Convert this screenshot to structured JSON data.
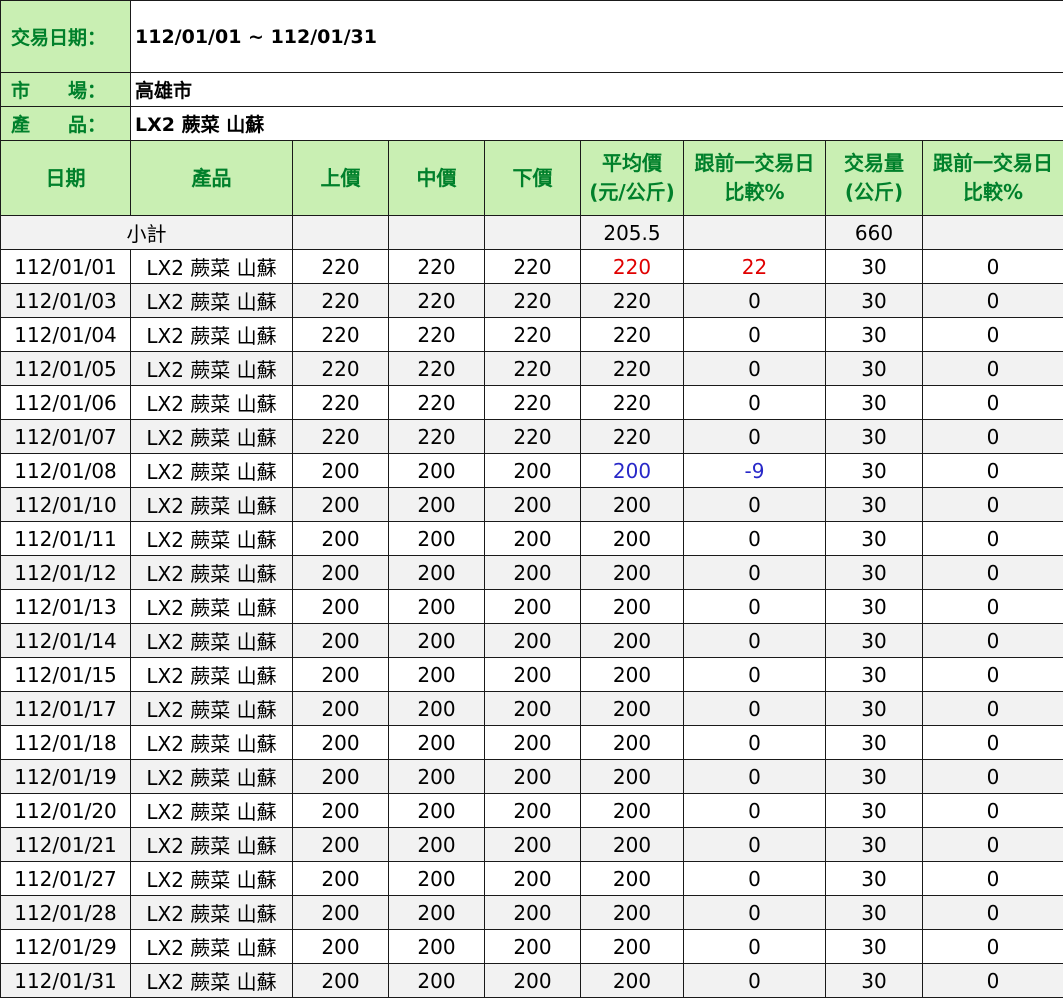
{
  "info": {
    "date_label": "交易日期：",
    "date_value": "112/01/01 ~ 112/01/31",
    "market_label": "市　　場：",
    "market_value": "高雄市",
    "product_label": "產　　品：",
    "product_value": "LX2 蕨菜 山蘇"
  },
  "headers": {
    "date": "日期",
    "product": "產品",
    "upper": "上價",
    "middle": "中價",
    "lower": "下價",
    "avg_line1": "平均價",
    "avg_line2": "(元/公斤)",
    "avg_cmp_line1": "跟前一交易日",
    "avg_cmp_line2": "比較%",
    "vol_line1": "交易量",
    "vol_line2": "(公斤)",
    "vol_cmp_line1": "跟前一交易日",
    "vol_cmp_line2": "比較%"
  },
  "subtotal": {
    "label": "小計",
    "avg": "205.5",
    "volume": "660"
  },
  "colors": {
    "header_bg": "#c9efb3",
    "header_text": "#00802b",
    "increase": "#e00000",
    "decrease": "#2828c8"
  },
  "rows": [
    {
      "date": "112/01/01",
      "product": "LX2 蕨菜 山蘇",
      "upper": "220",
      "middle": "220",
      "lower": "220",
      "avg": "220",
      "avg_cmp": "22",
      "volume": "30",
      "vol_cmp": "0",
      "trend": "up"
    },
    {
      "date": "112/01/03",
      "product": "LX2 蕨菜 山蘇",
      "upper": "220",
      "middle": "220",
      "lower": "220",
      "avg": "220",
      "avg_cmp": "0",
      "volume": "30",
      "vol_cmp": "0",
      "trend": ""
    },
    {
      "date": "112/01/04",
      "product": "LX2 蕨菜 山蘇",
      "upper": "220",
      "middle": "220",
      "lower": "220",
      "avg": "220",
      "avg_cmp": "0",
      "volume": "30",
      "vol_cmp": "0",
      "trend": ""
    },
    {
      "date": "112/01/05",
      "product": "LX2 蕨菜 山蘇",
      "upper": "220",
      "middle": "220",
      "lower": "220",
      "avg": "220",
      "avg_cmp": "0",
      "volume": "30",
      "vol_cmp": "0",
      "trend": ""
    },
    {
      "date": "112/01/06",
      "product": "LX2 蕨菜 山蘇",
      "upper": "220",
      "middle": "220",
      "lower": "220",
      "avg": "220",
      "avg_cmp": "0",
      "volume": "30",
      "vol_cmp": "0",
      "trend": ""
    },
    {
      "date": "112/01/07",
      "product": "LX2 蕨菜 山蘇",
      "upper": "220",
      "middle": "220",
      "lower": "220",
      "avg": "220",
      "avg_cmp": "0",
      "volume": "30",
      "vol_cmp": "0",
      "trend": ""
    },
    {
      "date": "112/01/08",
      "product": "LX2 蕨菜 山蘇",
      "upper": "200",
      "middle": "200",
      "lower": "200",
      "avg": "200",
      "avg_cmp": "-9",
      "volume": "30",
      "vol_cmp": "0",
      "trend": "down"
    },
    {
      "date": "112/01/10",
      "product": "LX2 蕨菜 山蘇",
      "upper": "200",
      "middle": "200",
      "lower": "200",
      "avg": "200",
      "avg_cmp": "0",
      "volume": "30",
      "vol_cmp": "0",
      "trend": ""
    },
    {
      "date": "112/01/11",
      "product": "LX2 蕨菜 山蘇",
      "upper": "200",
      "middle": "200",
      "lower": "200",
      "avg": "200",
      "avg_cmp": "0",
      "volume": "30",
      "vol_cmp": "0",
      "trend": ""
    },
    {
      "date": "112/01/12",
      "product": "LX2 蕨菜 山蘇",
      "upper": "200",
      "middle": "200",
      "lower": "200",
      "avg": "200",
      "avg_cmp": "0",
      "volume": "30",
      "vol_cmp": "0",
      "trend": ""
    },
    {
      "date": "112/01/13",
      "product": "LX2 蕨菜 山蘇",
      "upper": "200",
      "middle": "200",
      "lower": "200",
      "avg": "200",
      "avg_cmp": "0",
      "volume": "30",
      "vol_cmp": "0",
      "trend": ""
    },
    {
      "date": "112/01/14",
      "product": "LX2 蕨菜 山蘇",
      "upper": "200",
      "middle": "200",
      "lower": "200",
      "avg": "200",
      "avg_cmp": "0",
      "volume": "30",
      "vol_cmp": "0",
      "trend": ""
    },
    {
      "date": "112/01/15",
      "product": "LX2 蕨菜 山蘇",
      "upper": "200",
      "middle": "200",
      "lower": "200",
      "avg": "200",
      "avg_cmp": "0",
      "volume": "30",
      "vol_cmp": "0",
      "trend": ""
    },
    {
      "date": "112/01/17",
      "product": "LX2 蕨菜 山蘇",
      "upper": "200",
      "middle": "200",
      "lower": "200",
      "avg": "200",
      "avg_cmp": "0",
      "volume": "30",
      "vol_cmp": "0",
      "trend": ""
    },
    {
      "date": "112/01/18",
      "product": "LX2 蕨菜 山蘇",
      "upper": "200",
      "middle": "200",
      "lower": "200",
      "avg": "200",
      "avg_cmp": "0",
      "volume": "30",
      "vol_cmp": "0",
      "trend": ""
    },
    {
      "date": "112/01/19",
      "product": "LX2 蕨菜 山蘇",
      "upper": "200",
      "middle": "200",
      "lower": "200",
      "avg": "200",
      "avg_cmp": "0",
      "volume": "30",
      "vol_cmp": "0",
      "trend": ""
    },
    {
      "date": "112/01/20",
      "product": "LX2 蕨菜 山蘇",
      "upper": "200",
      "middle": "200",
      "lower": "200",
      "avg": "200",
      "avg_cmp": "0",
      "volume": "30",
      "vol_cmp": "0",
      "trend": ""
    },
    {
      "date": "112/01/21",
      "product": "LX2 蕨菜 山蘇",
      "upper": "200",
      "middle": "200",
      "lower": "200",
      "avg": "200",
      "avg_cmp": "0",
      "volume": "30",
      "vol_cmp": "0",
      "trend": ""
    },
    {
      "date": "112/01/27",
      "product": "LX2 蕨菜 山蘇",
      "upper": "200",
      "middle": "200",
      "lower": "200",
      "avg": "200",
      "avg_cmp": "0",
      "volume": "30",
      "vol_cmp": "0",
      "trend": ""
    },
    {
      "date": "112/01/28",
      "product": "LX2 蕨菜 山蘇",
      "upper": "200",
      "middle": "200",
      "lower": "200",
      "avg": "200",
      "avg_cmp": "0",
      "volume": "30",
      "vol_cmp": "0",
      "trend": ""
    },
    {
      "date": "112/01/29",
      "product": "LX2 蕨菜 山蘇",
      "upper": "200",
      "middle": "200",
      "lower": "200",
      "avg": "200",
      "avg_cmp": "0",
      "volume": "30",
      "vol_cmp": "0",
      "trend": ""
    },
    {
      "date": "112/01/31",
      "product": "LX2 蕨菜 山蘇",
      "upper": "200",
      "middle": "200",
      "lower": "200",
      "avg": "200",
      "avg_cmp": "0",
      "volume": "30",
      "vol_cmp": "0",
      "trend": ""
    }
  ]
}
